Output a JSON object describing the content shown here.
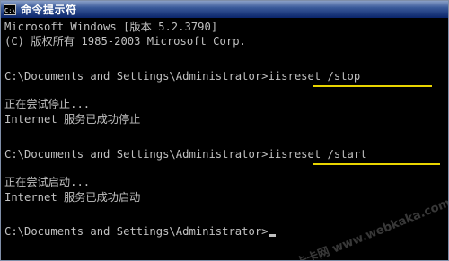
{
  "window": {
    "title": "命令提示符",
    "icon_text": "C:\\",
    "icon": "cmd-icon"
  },
  "console": {
    "lines": [
      "Microsoft Windows [版本 5.2.3790]",
      "(C) 版权所有 1985-2003 Microsoft Corp.",
      "",
      "C:\\Documents and Settings\\Administrator>",
      "",
      "正在尝试停止...",
      "Internet 服务已成功停止",
      "",
      "C:\\Documents and Settings\\Administrator>",
      "",
      "正在尝试启动...",
      "Internet 服务已成功启动",
      "",
      "C:\\Documents and Settings\\Administrator>"
    ],
    "cmd1": "iisreset /stop",
    "cmd2": "iisreset /start"
  },
  "watermark": "卡卡网 www.webkaka.com",
  "colors": {
    "background": "#000000",
    "text": "#c0c0c0",
    "underline": "#e8d400",
    "title_bar": "#0a246a"
  }
}
